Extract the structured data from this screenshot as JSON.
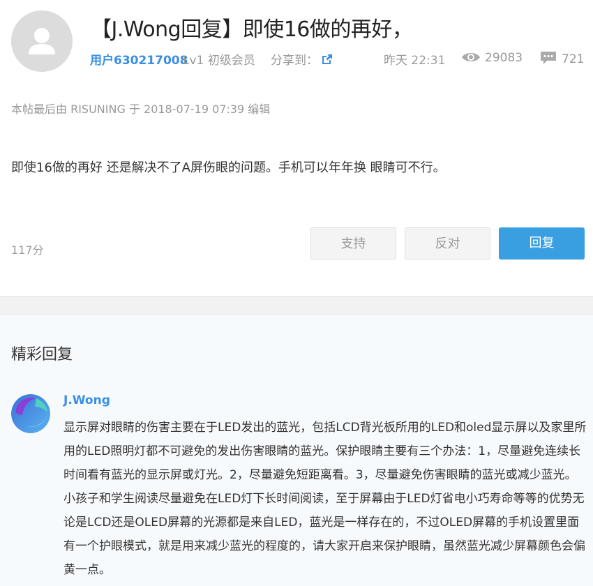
{
  "post": {
    "title": "【J.Wong回复】即使16做的再好，",
    "username": "用户630217008",
    "level": "Lv1 初级会员",
    "share_label": "分享到：",
    "time": "昨天 22:31",
    "views": "29083",
    "reply_count": "721",
    "edit_note": "本帖最后由 RISUNING 于 2018-07-19 07:39 编辑",
    "content": "即使16做的再好 还是解决不了A屏伤眼的问题。手机可以年年换 眼睛可不行。",
    "score": "117分",
    "buttons": {
      "support": "支持",
      "oppose": "反对",
      "reply": "回复"
    }
  },
  "featured": {
    "section_title": "精彩回复",
    "reply": {
      "author": "J.Wong",
      "text": "显示屏对眼睛的伤害主要在于LED发出的蓝光，包括LCD背光板所用的LED和oled显示屏以及家里所用的LED照明灯都不可避免的发出伤害眼睛的蓝光。保护眼睛主要有三个办法：1，尽量避免连续长时间看有蓝光的显示屏或灯光。2，尽量避免短距离看。3，尽量避免伤害眼睛的蓝光或减少蓝光。 小孩子和学生阅读尽量避免在LED灯下长时间阅读，至于屏幕由于LED灯省电小巧寿命等等的优势无论是LCD还是OLED屏幕的光源都是来自LED，蓝光是一样存在的，不过OLED屏幕的手机设置里面有一个护眼模式，就是用来减少蓝光的程度的，请大家开启来保护眼睛，虽然蓝光减少屏幕颜色会偏黄一点。"
    }
  },
  "icons": {
    "avatar": "default-user-avatar-icon",
    "share": "share-external-icon",
    "views": "eye-icon",
    "replies": "comment-icon",
    "reply_avatar": "colorful-swirl-avatar"
  },
  "colors": {
    "accent": "#3a8ee6",
    "reply_button": "#3a9fe0",
    "muted_text": "#999999",
    "featured_bg": "#f7fafd"
  }
}
